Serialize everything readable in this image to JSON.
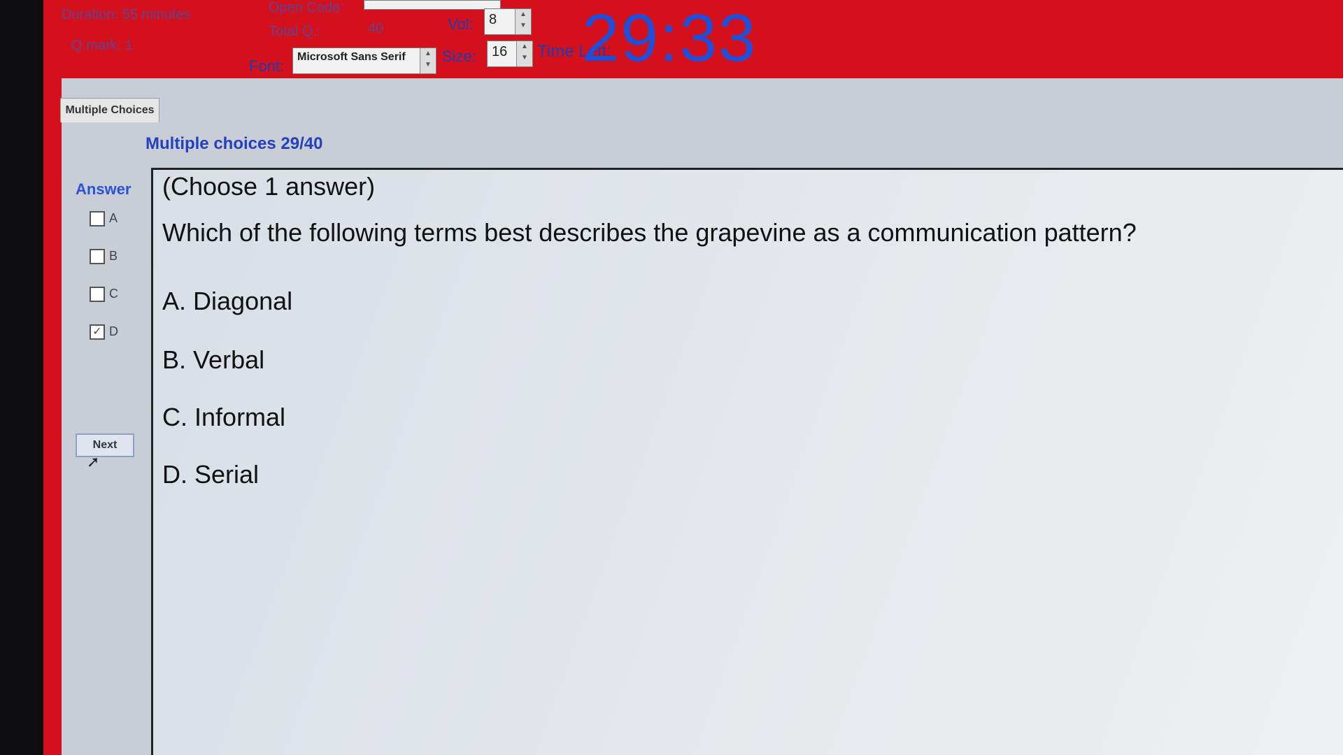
{
  "header": {
    "duration": "Duration: 55 minutes",
    "qmark": "Q.mark: 1",
    "open_code": "Open Code:",
    "total_label": "Total Q.:",
    "total_value": "40",
    "vol_label": "Vol:",
    "vol_value": "8",
    "font_label": "Font:",
    "font_value": "Microsoft Sans Serif",
    "size_label": "Size:",
    "size_value": "16",
    "time_left_label": "Time Left:",
    "time_left_value": "29:33"
  },
  "tab": {
    "label": "Multiple Choices"
  },
  "section": {
    "title": "Multiple choices 29/40"
  },
  "answer_panel": {
    "header": "Answer",
    "options": [
      {
        "label": "A",
        "checked": false
      },
      {
        "label": "B",
        "checked": false
      },
      {
        "label": "C",
        "checked": false
      },
      {
        "label": "D",
        "checked": true
      }
    ],
    "next_label": "Next"
  },
  "question": {
    "instruction": "(Choose 1 answer)",
    "text": "Which of the following terms best describes the grapevine as a communication pattern?",
    "choices": [
      {
        "letter": "A.",
        "text": "Diagonal"
      },
      {
        "letter": "B.",
        "text": "Verbal"
      },
      {
        "letter": "C.",
        "text": "Informal"
      },
      {
        "letter": "D.",
        "text": "Serial"
      }
    ]
  },
  "colors": {
    "accent_red": "#d5101d",
    "timer_blue": "#1f4fd8",
    "label_blue": "#2b52d8"
  }
}
